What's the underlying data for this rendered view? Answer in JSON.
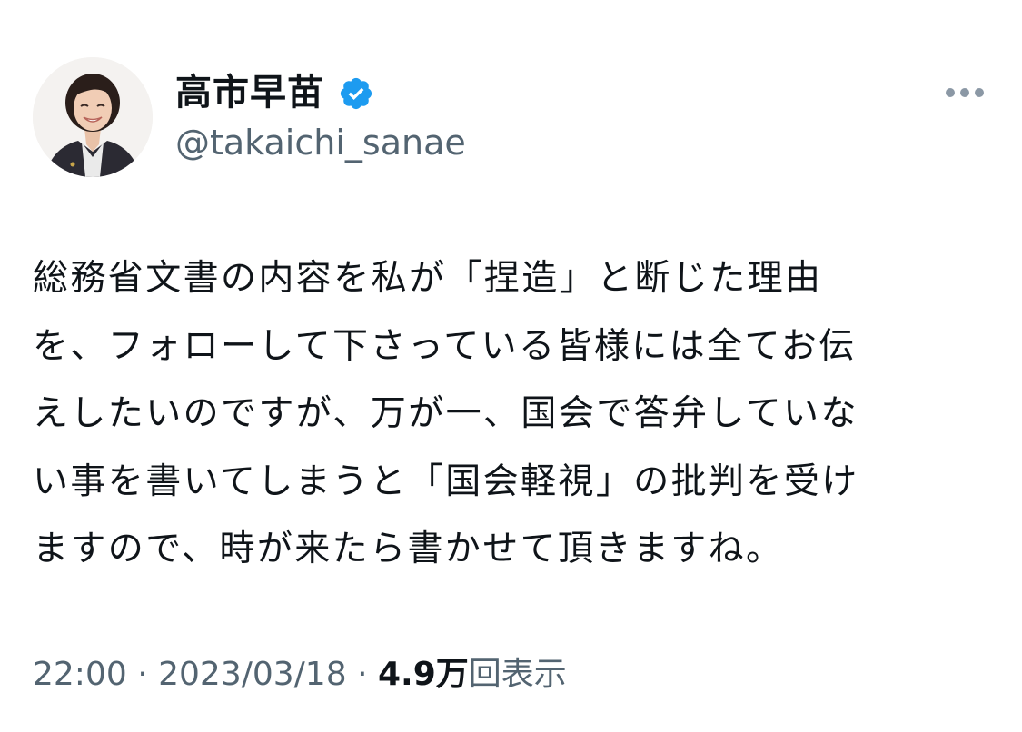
{
  "user": {
    "display_name": "高市早苗",
    "handle": "@takaichi_sanae",
    "verified": true
  },
  "tweet": {
    "lines": [
      "総務省文書の内容を私が「捏造」と断じた理由",
      "を、フォローして下さっている皆様には全てお伝",
      "えしたいのですが、万が一、国会で答弁していな",
      "い事を書いてしまうと「国会軽視」の批判を受け",
      "ますので、時が来たら書かせて頂きますね。"
    ],
    "time": "22:00",
    "separator": "·",
    "date": "2023/03/18",
    "views_count": "4.9万",
    "views_label": "回表示"
  },
  "colors": {
    "text": "#0f1419",
    "secondary": "#536471",
    "verified_badge": "#1d9bf0"
  },
  "icons": {
    "verified": "verified-badge-icon",
    "more": "more-options-icon"
  }
}
